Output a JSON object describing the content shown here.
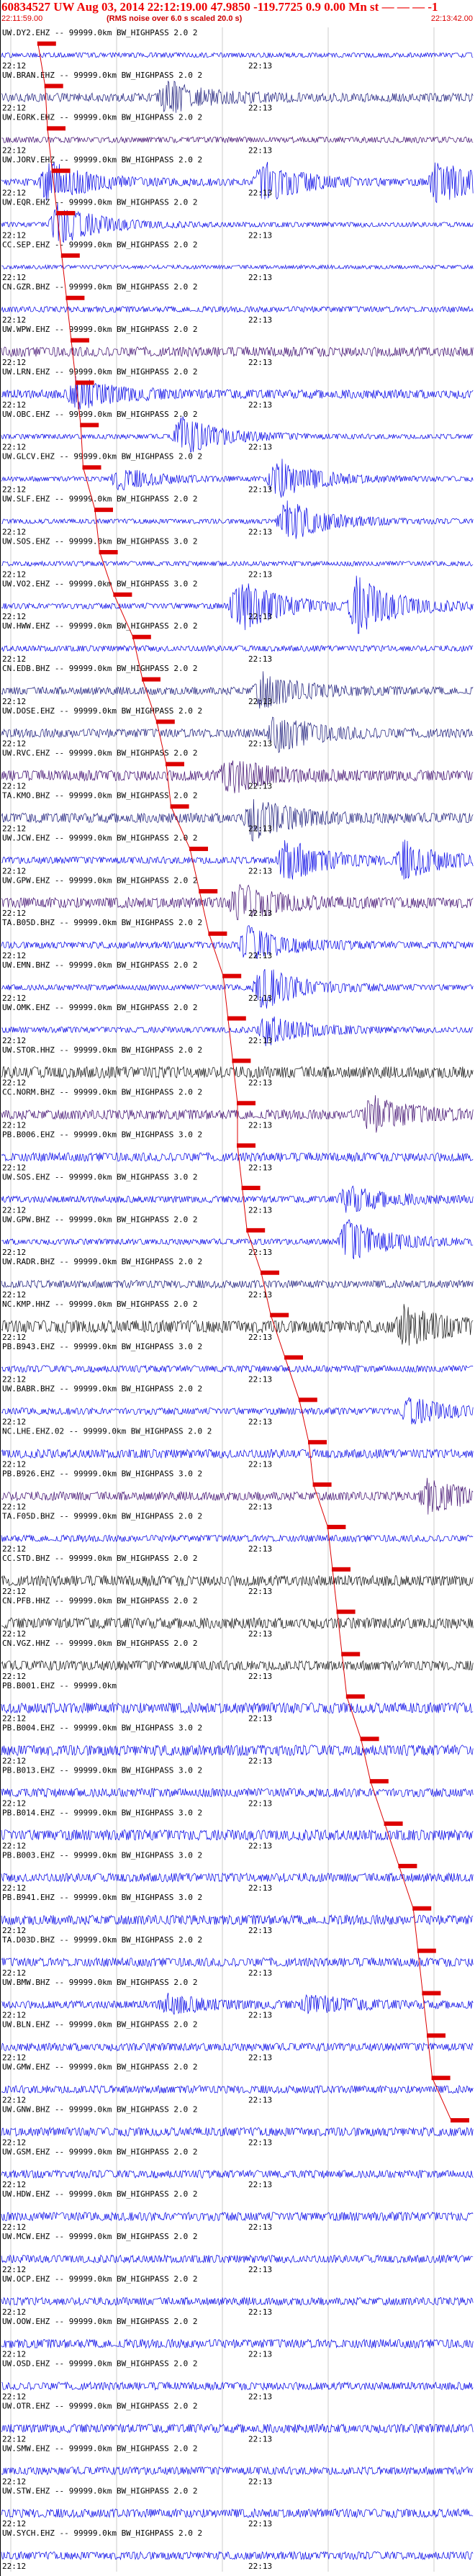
{
  "header": {
    "title": "60834527 UW Aug 03, 2014 22:12:19.00   47.9850  -119.7725  0.9 0.00 Mn st — — — -1",
    "subtitle": "(RMS noise over 6.0 s scaled 20.0 s)",
    "start_time": "22:11:59.00",
    "end_time": "22:13:42.00"
  },
  "chart_data": {
    "type": "line",
    "title": "60834527 UW Aug 03, 2014 22:12:19.00   47.9850  -119.7725  0.9 0.00 Mn st — — — -1",
    "subtitle": "(RMS noise over 6.0 s scaled 20.0 s)",
    "x_start": "22:11:59.00",
    "x_end": "22:13:42.00",
    "grid": true,
    "colors": {
      "blue": "#0000e6",
      "navy": "#1a1a7a",
      "purple": "#3d0a6e",
      "black": "#111111",
      "pick": "#dd0000"
    },
    "traces": [
      {
        "channel": "UW.DY2.EHZ -- 99999.0km BW_HIGHPASS 2.0 2",
        "amp": 0.25,
        "color": "blue",
        "events": []
      },
      {
        "channel": "UW.BRAN.EHZ -- 99999.0km BW_HIGHPASS 2.0 2",
        "amp": 0.45,
        "color": "navy",
        "events": [
          {
            "t": 0.35,
            "a": 0.7
          }
        ]
      },
      {
        "channel": "UW.EORK.EHZ -- 99999.0km BW_HIGHPASS 2.0 2",
        "amp": 0.3,
        "color": "purple",
        "events": []
      },
      {
        "channel": "UW.JORV.EHZ -- 99999.0km BW_HIGHPASS 2.0 2",
        "amp": 0.35,
        "color": "blue",
        "events": [
          {
            "t": 0.1,
            "a": 1.0
          },
          {
            "t": 0.55,
            "a": 1.0
          },
          {
            "t": 0.92,
            "a": 1.0
          }
        ]
      },
      {
        "channel": "UW.EQR.EHZ -- 99999.0km BW_HIGHPASS 2.0 2",
        "amp": 0.25,
        "color": "blue",
        "events": [
          {
            "t": 0.12,
            "a": 1.0
          }
        ]
      },
      {
        "channel": "CC.SEP.EHZ -- 99999.0km BW_HIGHPASS 2.0 2",
        "amp": 0.2,
        "color": "blue",
        "events": []
      },
      {
        "channel": "CN.GZR.BHZ -- 99999.0km BW_HIGHPASS 2.0 2",
        "amp": 0.3,
        "color": "blue",
        "events": []
      },
      {
        "channel": "UW.WPW.EHZ -- 99999.0km BW_HIGHPASS 2.0 2",
        "amp": 0.5,
        "color": "purple",
        "events": []
      },
      {
        "channel": "UW.LRN.EHZ -- 99999.0km BW_HIGHPASS 2.0 2",
        "amp": 0.45,
        "color": "blue",
        "events": [
          {
            "t": 0.16,
            "a": 0.7
          }
        ]
      },
      {
        "channel": "UW.OBC.EHZ -- 99999.0km BW_HIGHPASS 2.0 2",
        "amp": 0.25,
        "color": "blue",
        "events": [
          {
            "t": 0.38,
            "a": 0.9
          }
        ]
      },
      {
        "channel": "UW.GLCV.EHZ -- 99999.0km BW_HIGHPASS 2.0 2",
        "amp": 0.25,
        "color": "blue",
        "events": [
          {
            "t": 0.25,
            "a": 0.5
          },
          {
            "t": 0.58,
            "a": 1.0
          }
        ]
      },
      {
        "channel": "UW.SLF.EHZ -- 99999.0km BW_HIGHPASS 2.0 2",
        "amp": 0.25,
        "color": "blue",
        "events": [
          {
            "t": 0.6,
            "a": 1.0
          }
        ]
      },
      {
        "channel": "UW.SOS.EHZ -- 99999.0km BW_HIGHPASS 3.0 2",
        "amp": 0.25,
        "color": "blue",
        "events": []
      },
      {
        "channel": "UW.VO2.EHZ -- 99999.0km BW_HIGHPASS 3.0 2",
        "amp": 0.3,
        "color": "blue",
        "events": [
          {
            "t": 0.5,
            "a": 1.3
          },
          {
            "t": 0.75,
            "a": 1.3
          }
        ]
      },
      {
        "channel": "UW.HWW.EHZ -- 99999.0km BW_HIGHPASS 2.0 2",
        "amp": 0.3,
        "color": "blue",
        "events": []
      },
      {
        "channel": "CN.EDB.BHZ -- 99999.0km BW_HIGHPASS 2.0 2",
        "amp": 0.4,
        "color": "navy",
        "events": [
          {
            "t": 0.55,
            "a": 0.8
          }
        ]
      },
      {
        "channel": "UW.DOSE.EHZ -- 99999.0km BW_HIGHPASS 2.0 2",
        "amp": 0.45,
        "color": "navy",
        "events": [
          {
            "t": 0.58,
            "a": 0.8
          }
        ]
      },
      {
        "channel": "UW.RVC.EHZ -- 99999.0km BW_HIGHPASS 2.0 2",
        "amp": 0.55,
        "color": "purple",
        "events": [
          {
            "t": 0.48,
            "a": 0.8
          }
        ]
      },
      {
        "channel": "TA.KMO.BHZ -- 99999.0km BW_HIGHPASS 2.0 2",
        "amp": 0.5,
        "color": "navy",
        "events": [
          {
            "t": 0.53,
            "a": 0.9
          }
        ]
      },
      {
        "channel": "UW.JCW.EHZ -- 99999.0km BW_HIGHPASS 2.0 2",
        "amp": 0.35,
        "color": "blue",
        "events": [
          {
            "t": 0.6,
            "a": 1.0
          },
          {
            "t": 0.85,
            "a": 0.8
          }
        ]
      },
      {
        "channel": "UW.GPW.EHZ -- 99999.0km BW_HIGHPASS 2.0 2",
        "amp": 0.55,
        "color": "purple",
        "events": [
          {
            "t": 0.5,
            "a": 0.8
          }
        ]
      },
      {
        "channel": "TA.B05D.BHZ -- 99999.0km BW_HIGHPASS 2.0 2",
        "amp": 0.35,
        "color": "blue",
        "events": [
          {
            "t": 0.52,
            "a": 0.8
          }
        ]
      },
      {
        "channel": "UW.EMN.BHZ -- 99999.0km BW_HIGHPASS 2.0 2",
        "amp": 0.3,
        "color": "blue",
        "events": [
          {
            "t": 0.55,
            "a": 1.0
          }
        ]
      },
      {
        "channel": "UW.OMK.EHZ -- 99999.0km BW_HIGHPASS 2.0 2",
        "amp": 0.3,
        "color": "blue",
        "events": [
          {
            "t": 0.56,
            "a": 0.7
          }
        ]
      },
      {
        "channel": "UW.STOR.HHZ -- 99999.0km BW_HIGHPASS 2.0 2",
        "amp": 0.6,
        "color": "black",
        "events": []
      },
      {
        "channel": "CC.NORM.BHZ -- 99999.0km BW_HIGHPASS 2.0 2",
        "amp": 0.5,
        "color": "purple",
        "events": [
          {
            "t": 0.78,
            "a": 0.8
          }
        ]
      },
      {
        "channel": "PB.B006.EHZ -- 99999.0km BW_HIGHPASS 3.0 2",
        "amp": 0.45,
        "color": "blue",
        "events": []
      },
      {
        "channel": "UW.SOS.EHZ -- 99999.0km BW_HIGHPASS 3.0 2",
        "amp": 0.35,
        "color": "blue",
        "events": [
          {
            "t": 0.73,
            "a": 0.6
          }
        ]
      },
      {
        "channel": "UW.GPW.BHZ -- 99999.0km BW_HIGHPASS 2.0 2",
        "amp": 0.3,
        "color": "blue",
        "events": [
          {
            "t": 0.73,
            "a": 1.0
          }
        ]
      },
      {
        "channel": "UW.RADR.BHZ -- 99999.0km BW_HIGHPASS 2.0 2",
        "amp": 0.4,
        "color": "navy",
        "events": []
      },
      {
        "channel": "NC.KMP.HHZ -- 99999.0km BW_HIGHPASS 2.0 2",
        "amp": 0.65,
        "color": "black",
        "events": [
          {
            "t": 0.85,
            "a": 0.8
          }
        ]
      },
      {
        "channel": "PB.B943.EHZ -- 99999.0km BW_HIGHPASS 3.0 2",
        "amp": 0.35,
        "color": "blue",
        "events": []
      },
      {
        "channel": "UW.BABR.BHZ -- 99999.0km BW_HIGHPASS 2.0 2",
        "amp": 0.35,
        "color": "blue",
        "events": [
          {
            "t": 0.86,
            "a": 0.6
          }
        ]
      },
      {
        "channel": "NC.LHE.EHZ.02 -- 99999.0km BW_HIGHPASS 2.0 2",
        "amp": 0.45,
        "color": "blue",
        "events": []
      },
      {
        "channel": "PB.B926.EHZ -- 99999.0km BW_HIGHPASS 3.0 2",
        "amp": 0.45,
        "color": "purple",
        "events": [
          {
            "t": 0.9,
            "a": 0.7
          }
        ]
      },
      {
        "channel": "TA.F05D.BHZ -- 99999.0km BW_HIGHPASS 2.0 2",
        "amp": 0.35,
        "color": "blue",
        "events": []
      },
      {
        "channel": "CC.STD.BHZ -- 99999.0km BW_HIGHPASS 2.0 2",
        "amp": 0.55,
        "color": "black",
        "events": []
      },
      {
        "channel": "CN.PFB.HHZ -- 99999.0km BW_HIGHPASS 2.0 2",
        "amp": 0.55,
        "color": "black",
        "events": []
      },
      {
        "channel": "CN.VGZ.HHZ -- 99999.0km BW_HIGHPASS 2.0 2",
        "amp": 0.5,
        "color": "black",
        "events": []
      },
      {
        "channel": "PB.B001.EHZ -- 99999.0km",
        "amp": 0.55,
        "color": "blue",
        "events": []
      },
      {
        "channel": "PB.B004.EHZ -- 99999.0km BW_HIGHPASS 3.0 2",
        "amp": 0.55,
        "color": "blue",
        "events": []
      },
      {
        "channel": "PB.B013.EHZ -- 99999.0km BW_HIGHPASS 3.0 2",
        "amp": 0.45,
        "color": "blue",
        "events": []
      },
      {
        "channel": "PB.B014.EHZ -- 99999.0km BW_HIGHPASS 3.0 2",
        "amp": 0.55,
        "color": "blue",
        "events": []
      },
      {
        "channel": "PB.B003.EHZ -- 99999.0km BW_HIGHPASS 3.0 2",
        "amp": 0.45,
        "color": "blue",
        "events": []
      },
      {
        "channel": "PB.B941.EHZ -- 99999.0km BW_HIGHPASS 3.0 2",
        "amp": 0.5,
        "color": "blue",
        "events": []
      },
      {
        "channel": "TA.D03D.BHZ -- 99999.0km BW_HIGHPASS 2.0 2",
        "amp": 0.45,
        "color": "blue",
        "events": []
      },
      {
        "channel": "UW.BMW.BHZ -- 99999.0km BW_HIGHPASS 2.0 2",
        "amp": 0.4,
        "color": "blue",
        "events": [
          {
            "t": 0.35,
            "a": 0.4
          },
          {
            "t": 0.65,
            "a": 0.4
          }
        ]
      },
      {
        "channel": "UW.BLN.EHZ -- 99999.0km BW_HIGHPASS 2.0 2",
        "amp": 0.4,
        "color": "blue",
        "events": []
      },
      {
        "channel": "UW.GMW.EHZ -- 99999.0km BW_HIGHPASS 2.0 2",
        "amp": 0.4,
        "color": "blue",
        "events": []
      },
      {
        "channel": "UW.GNW.BHZ -- 99999.0km BW_HIGHPASS 2.0 2",
        "amp": 0.45,
        "color": "blue",
        "events": []
      },
      {
        "channel": "UW.GSM.EHZ -- 99999.0km BW_HIGHPASS 2.0 2",
        "amp": 0.4,
        "color": "blue",
        "events": []
      },
      {
        "channel": "UW.HDW.EHZ -- 99999.0km BW_HIGHPASS 2.0 2",
        "amp": 0.45,
        "color": "blue",
        "events": []
      },
      {
        "channel": "UW.MCW.EHZ -- 99999.0km BW_HIGHPASS 2.0 2",
        "amp": 0.4,
        "color": "blue",
        "events": []
      },
      {
        "channel": "UW.OCP.EHZ -- 99999.0km BW_HIGHPASS 2.0 2",
        "amp": 0.4,
        "color": "blue",
        "events": []
      },
      {
        "channel": "UW.OOW.EHZ -- 99999.0km BW_HIGHPASS 2.0 2",
        "amp": 0.45,
        "color": "blue",
        "events": []
      },
      {
        "channel": "UW.OSD.EHZ -- 99999.0km BW_HIGHPASS 2.0 2",
        "amp": 0.4,
        "color": "blue",
        "events": []
      },
      {
        "channel": "UW.OTR.EHZ -- 99999.0km BW_HIGHPASS 2.0 2",
        "amp": 0.45,
        "color": "blue",
        "events": []
      },
      {
        "channel": "UW.SMW.EHZ -- 99999.0km BW_HIGHPASS 2.0 2",
        "amp": 0.4,
        "color": "blue",
        "events": []
      },
      {
        "channel": "UW.STW.EHZ -- 99999.0km BW_HIGHPASS 2.0 2",
        "amp": 0.45,
        "color": "blue",
        "events": []
      },
      {
        "channel": "UW.SYCH.EHZ -- 99999.0km BW_HIGHPASS 2.0 2",
        "amp": 0.4,
        "color": "blue",
        "events": []
      }
    ],
    "time_labels": [
      "22:12",
      "22:13"
    ],
    "picks": [
      0.08,
      0.095,
      0.1,
      0.11,
      0.12,
      0.13,
      0.14,
      0.15,
      0.16,
      0.17,
      0.175,
      0.2,
      0.21,
      0.24,
      0.28,
      0.3,
      0.33,
      0.35,
      0.36,
      0.4,
      0.42,
      0.44,
      0.47,
      0.48,
      0.49,
      0.5,
      0.5,
      0.51,
      0.52,
      0.55,
      0.57,
      0.6,
      0.63,
      0.65,
      0.66,
      0.69,
      0.7,
      0.71,
      0.72,
      0.73,
      0.76,
      0.78,
      0.81,
      0.84,
      0.87,
      0.88,
      0.89,
      0.9,
      0.91,
      0.95
    ]
  }
}
